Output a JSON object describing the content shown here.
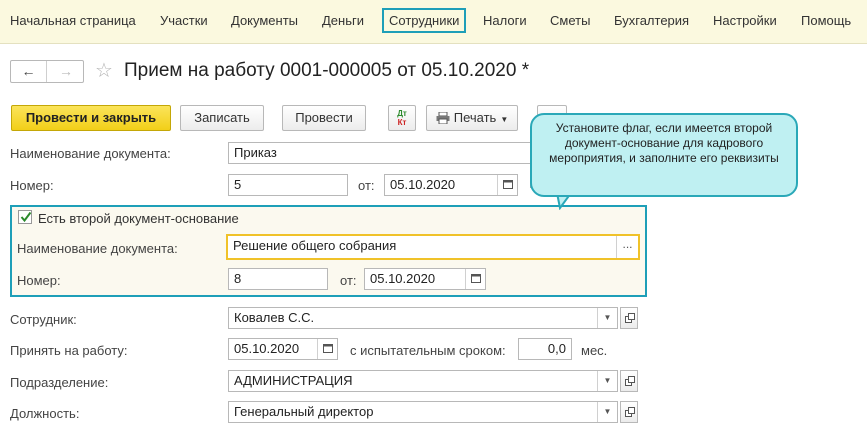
{
  "nav": {
    "items": [
      "Начальная страница",
      "Участки",
      "Документы",
      "Деньги",
      "Сотрудники",
      "Налоги",
      "Сметы",
      "Бухгалтерия",
      "Настройки",
      "Помощь"
    ],
    "active_index": 4
  },
  "header": {
    "title": "Прием на работу 0001-000005 от 05.10.2020 *",
    "back_icon": "←",
    "forward_icon": "→",
    "star_icon": "☆"
  },
  "toolbar": {
    "post_close_label": "Провести и закрыть",
    "save_label": "Записать",
    "post_label": "Провести",
    "dtkt_top": "Дт",
    "dtkt_bottom": "Кт",
    "print_label": "Печать"
  },
  "form": {
    "doc_name_label": "Наименование документа:",
    "doc_name_value": "Приказ",
    "number_label": "Номер:",
    "number_value": "5",
    "date_label": "от:",
    "date_value": "05.10.2020",
    "second_doc": {
      "checkbox_label": "Есть второй документ-основание",
      "checked": true,
      "doc_name_label": "Наименование документа:",
      "doc_name_value": "Решение общего собрания",
      "dots": "...",
      "number_label": "Номер:",
      "number_value": "8",
      "date_label": "от:",
      "date_value": "05.10.2020"
    },
    "employee_label": "Сотрудник:",
    "employee_value": "Ковалев С.С.",
    "hire_label": "Принять на работу:",
    "hire_date": "05.10.2020",
    "trial_label": "с испытательным сроком:",
    "trial_value": "0,0",
    "trial_unit": "мес.",
    "department_label": "Подразделение:",
    "department_value": "АДМИНИСТРАЦИЯ",
    "position_label": "Должность:",
    "position_value": "Генеральный директор"
  },
  "tooltip": {
    "text": "Установите флаг, если имеется второй документ-основание для кадрового мероприятия, и заполните его реквизиты"
  },
  "colors": {
    "accent": "#1e9fb8",
    "primary_button": "#f2cf18",
    "nav_bg": "#fbf9df",
    "tooltip_bg": "#bff0f2"
  }
}
